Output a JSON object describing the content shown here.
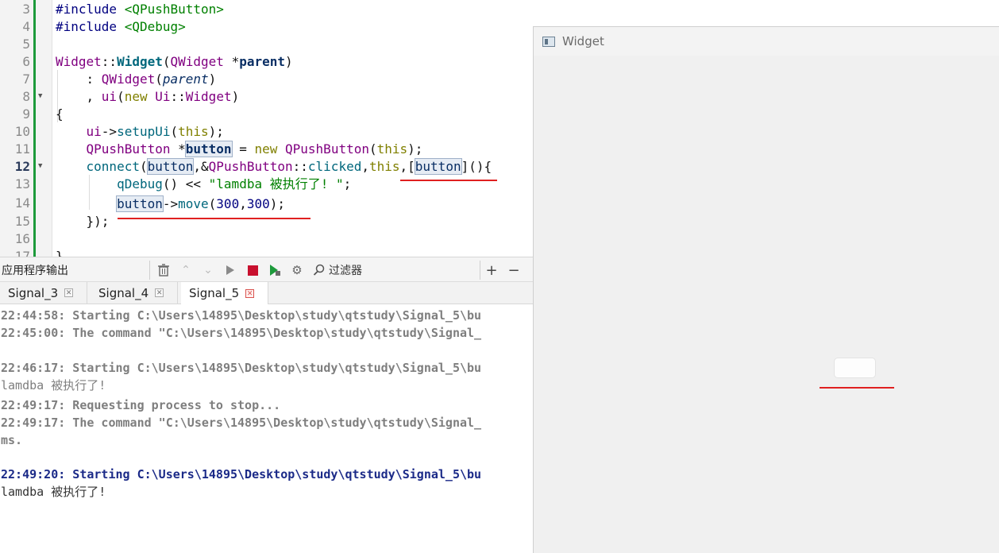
{
  "editor": {
    "line_numbers": [
      "3",
      "4",
      "5",
      "6",
      "7",
      "8",
      "9",
      "10",
      "11",
      "12",
      "13",
      "14",
      "15",
      "16",
      "17"
    ],
    "current_line": "12"
  },
  "output_pane": {
    "title": "应用程序输出",
    "filter_label": "过滤器",
    "tabs": [
      {
        "label": "Signal_3",
        "active": false
      },
      {
        "label": "Signal_4",
        "active": false
      },
      {
        "label": "Signal_5",
        "active": true
      }
    ],
    "lines": [
      "22:44:58: Starting C:\\Users\\14895\\Desktop\\study\\qtstudy\\Signal_5\\bu",
      "22:45:00: The command \"C:\\Users\\14895\\Desktop\\study\\qtstudy\\Signal_",
      "22:46:17: Starting C:\\Users\\14895\\Desktop\\study\\qtstudy\\Signal_5\\bu",
      "lamdba 被执行了!",
      "22:49:17: Requesting process to stop...",
      "22:49:17: The command \"C:\\Users\\14895\\Desktop\\study\\qtstudy\\Signal_",
      "ms.",
      "22:49:20: Starting C:\\Users\\14895\\Desktop\\study\\qtstudy\\Signal_5\\bu",
      "lamdba 被执行了!"
    ]
  },
  "widget_window": {
    "title": "Widget"
  },
  "colors": {
    "accent_red": "#e02020",
    "gutter_green": "#1d9a3b",
    "run_start_blue": "#1b2a88"
  }
}
